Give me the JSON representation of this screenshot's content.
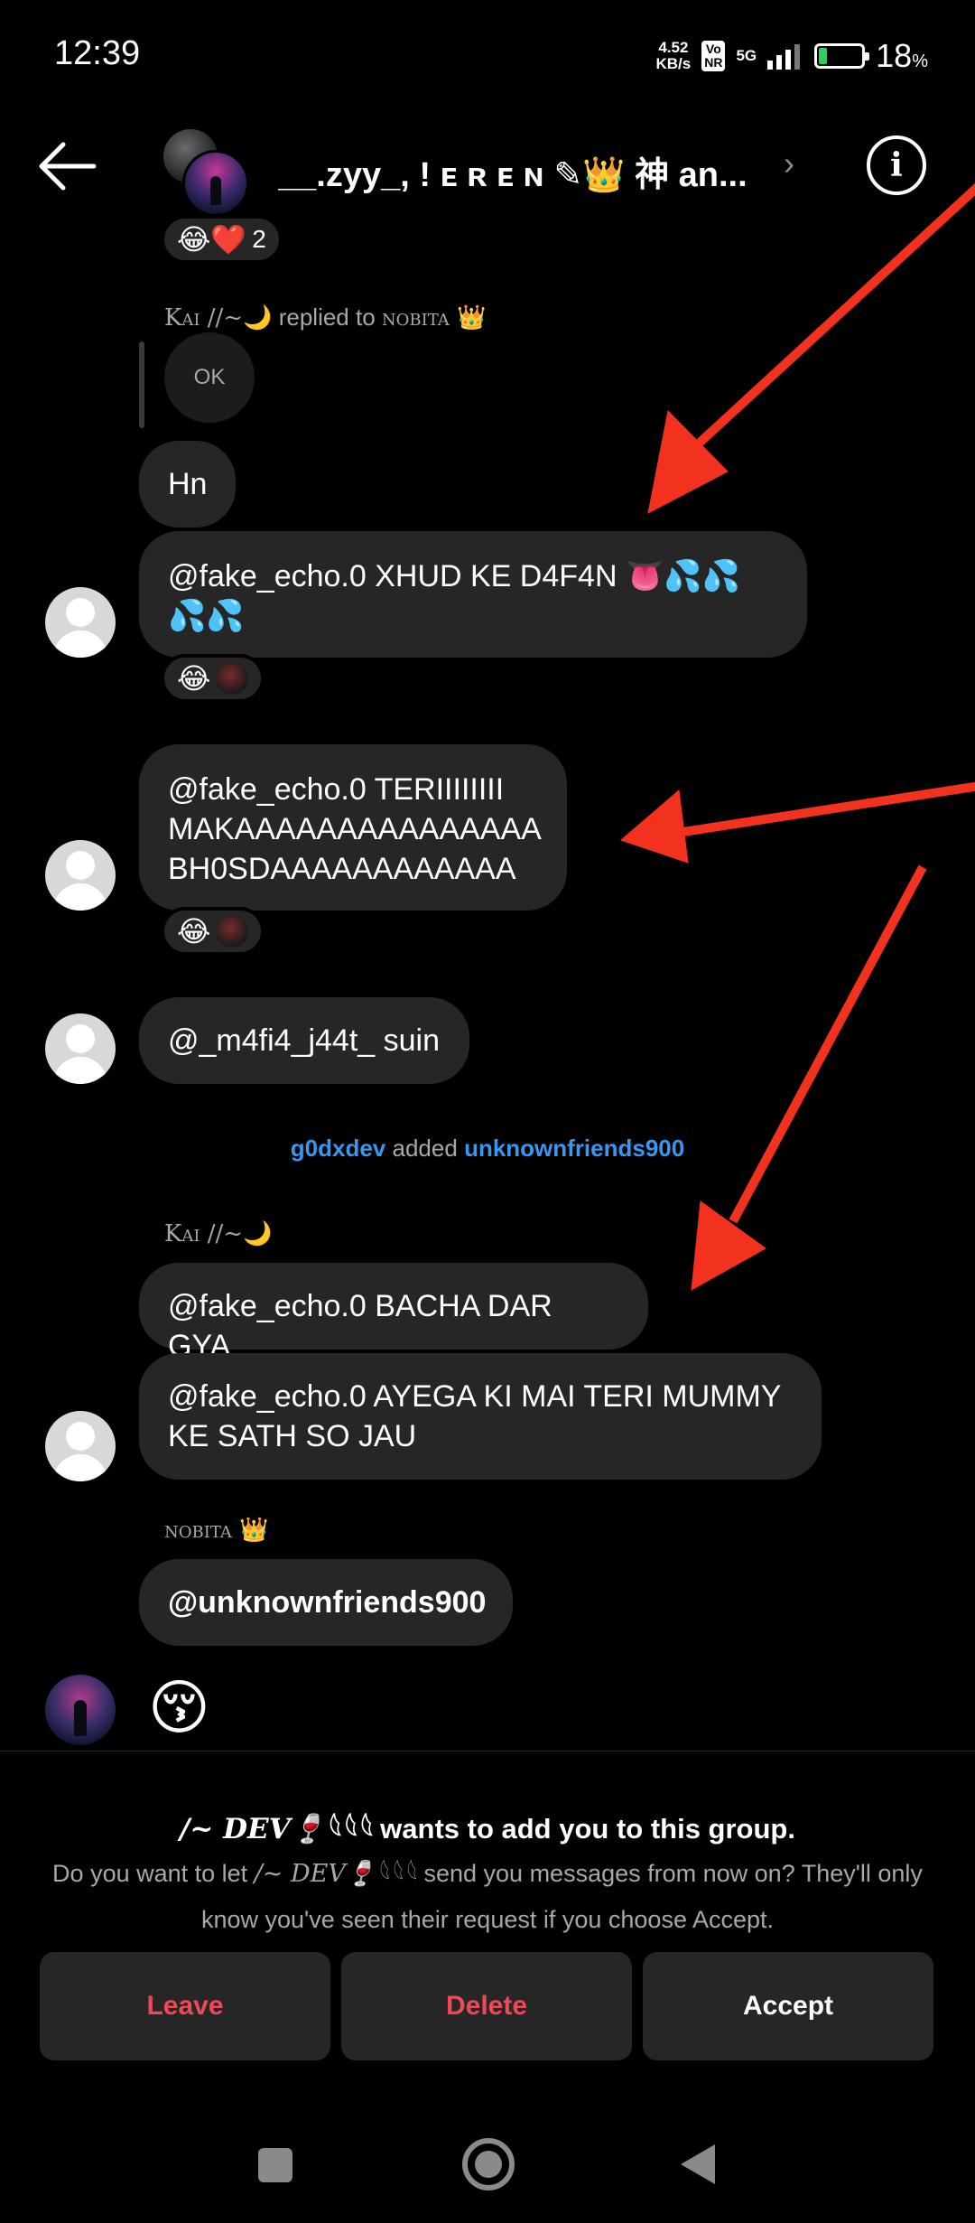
{
  "status_bar": {
    "time": "12:39",
    "net_speed_value": "4.52",
    "net_speed_unit": "KB/s",
    "volte_top": "Vo",
    "volte_bottom": "NR",
    "signal": "5G",
    "battery_percent": "18",
    "battery_unit": "%"
  },
  "header": {
    "group_title": "__.zyy_, ! ᴇ ʀ ᴇ ɴ ✎👑 神 an...",
    "chevron": "›",
    "info_glyph": "i"
  },
  "messages": {
    "top_reaction": {
      "emojis": "😂❤️",
      "count": "2"
    },
    "kai_reply": {
      "sender": "Kai //~🌙",
      "reply_text": "replied to",
      "target": "nobita 👑",
      "quoted": "OK"
    },
    "hn": "Hn",
    "m1": "@fake_echo.0 XHUD KE D4F4N 👅💦💦💦💦",
    "m1_reaction": "😂",
    "m2": "@fake_echo.0 TERIIIIIIII MAKAAAAAAAAAAAAAAA BH0SDAAAAAAAAAAAA",
    "m2_reaction": "😂",
    "m3": "@_m4fi4_j44t_ suin",
    "system": {
      "actor": "g0dxdev",
      "verb": "added",
      "object": "unknownfriends900"
    },
    "kai_sender": "Kai //~🌙",
    "m4": "@fake_echo.0 BACHA DAR GYA",
    "m5": "@fake_echo.0 AYEGA KI MAI TERI MUMMY KE SATH SO JAU",
    "nobita_sender": "nobita 👑",
    "m6": "@unknownfriends900",
    "m7_emoji": "😚"
  },
  "request": {
    "name": "/~ DEV🍷𓆩𓆩𓆩",
    "title_suffix": " wants to add you to this group.",
    "body_prefix": "Do you want to let ",
    "body_suffix": " send you messages from now on? They'll only know you've seen their request if you choose Accept.",
    "leave_label": "Leave",
    "delete_label": "Delete",
    "accept_label": "Accept"
  },
  "colors": {
    "background": "#000000",
    "bubble": "#262626",
    "link_blue": "#3897f0",
    "danger_red": "#ed4956",
    "annotation_arrow": "#f2321f"
  }
}
